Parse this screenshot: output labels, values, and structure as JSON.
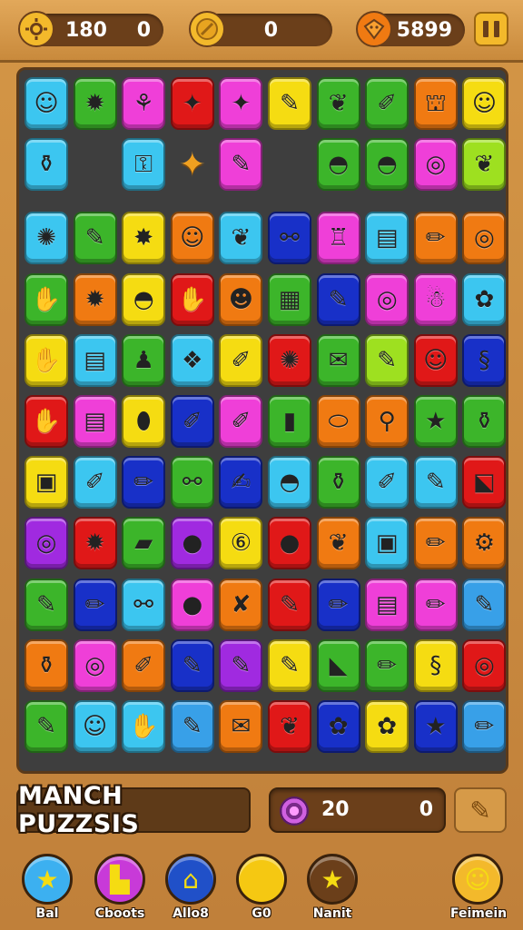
{
  "topbar": {
    "coins": {
      "icon": "sun-coin-icon",
      "value1": "180",
      "value2": "0"
    },
    "center": {
      "icon": "gold-coin-icon",
      "value": "0"
    },
    "gems": {
      "icon": "orange-gem-icon",
      "value": "5899"
    },
    "pause_icon": "pause-icon"
  },
  "colors": {
    "r": "#e01818",
    "o": "#f07a12",
    "y": "#f5dc12",
    "g": "#3cb52a",
    "c": "#3cc6f0",
    "b": "#1830c8",
    "p": "#a02ae0",
    "m": "#ef3fd8",
    "l": "#9ee020",
    "k": "#38a0e8"
  },
  "rows": [
    [
      "c:☺",
      "g:✹",
      "m:⚘",
      "r:✦",
      "m:✦",
      "y:✎",
      "g:❦",
      "g:✐",
      "o:⛫",
      "y:☺"
    ],
    [
      "c:⚱",
      "_",
      "c:⚿",
      "*:✦",
      "m:✎",
      "_",
      "g:◓",
      "g:◓",
      "m:◎",
      "l:❦"
    ],
    [
      "c:✺",
      "g:✎",
      "y:✸",
      "o:☺",
      "c:❦",
      "b:⚯",
      "m:♖",
      "c:▤",
      "o:✏",
      "o:◎"
    ],
    [
      "g:✋",
      "o:✹",
      "y:◓",
      "r:✋",
      "o:☻",
      "g:▦",
      "b:✎",
      "m:◎",
      "m:☃",
      "c:✿"
    ],
    [
      "y:✋",
      "c:▤",
      "g:♟",
      "c:❖",
      "y:✐",
      "r:✺",
      "g:✉",
      "l:✎",
      "r:☺",
      "b:§"
    ],
    [
      "r:✋",
      "m:▤",
      "y:⬮",
      "b:✐",
      "m:✐",
      "g:▮",
      "o:⬭",
      "o:⚲",
      "g:★",
      "g:⚱"
    ],
    [
      "y:▣",
      "c:✐",
      "b:✏",
      "g:⚯",
      "b:✍",
      "c:◓",
      "g:⚱",
      "c:✐",
      "c:✎",
      "r:⬕"
    ],
    [
      "p:◎",
      "r:✹",
      "g:▰",
      "p:●",
      "y:⑥",
      "r:●",
      "o:❦",
      "c:▣",
      "o:✏",
      "o:⚙"
    ],
    [
      "g:✎",
      "b:✏",
      "c:⚯",
      "m:●",
      "o:✘",
      "r:✎",
      "b:✏",
      "m:▤",
      "m:✏",
      "k:✎"
    ],
    [
      "o:⚱",
      "m:◎",
      "o:✐",
      "b:✎",
      "p:✎",
      "y:✎",
      "g:◣",
      "g:✏",
      "y:§",
      "r:◎"
    ],
    [
      "g:✎",
      "c:☺",
      "c:✋",
      "k:✎",
      "o:✉",
      "r:❦",
      "b:✿",
      "y:✿",
      "b:★",
      "k:✏"
    ]
  ],
  "bottom": {
    "title": "MANCH PUZZSIS",
    "score_icon": "swirl-target-icon",
    "score_a": "20",
    "score_b": "0",
    "tool_icon": "hammer-icon"
  },
  "nav": [
    {
      "label": "Bal",
      "icon": "star-icon",
      "color": "#3cb0f0",
      "glyph": "★"
    },
    {
      "label": "Cboots",
      "icon": "gift-icon",
      "color": "#c83ad8",
      "glyph": "▙"
    },
    {
      "label": "Allo8",
      "icon": "home-icon",
      "color": "#2050c8",
      "glyph": "⌂"
    },
    {
      "label": "G0",
      "icon": "gold-coin-icon",
      "color": "#f5c812",
      "glyph": "●"
    },
    {
      "label": "Nanit",
      "icon": "star-badge-icon",
      "color": "#6b3f1a",
      "glyph": "★"
    },
    {
      "label": "Feimein",
      "icon": "profile-avatar-icon",
      "color": "#f3b92b",
      "glyph": "☺"
    }
  ]
}
